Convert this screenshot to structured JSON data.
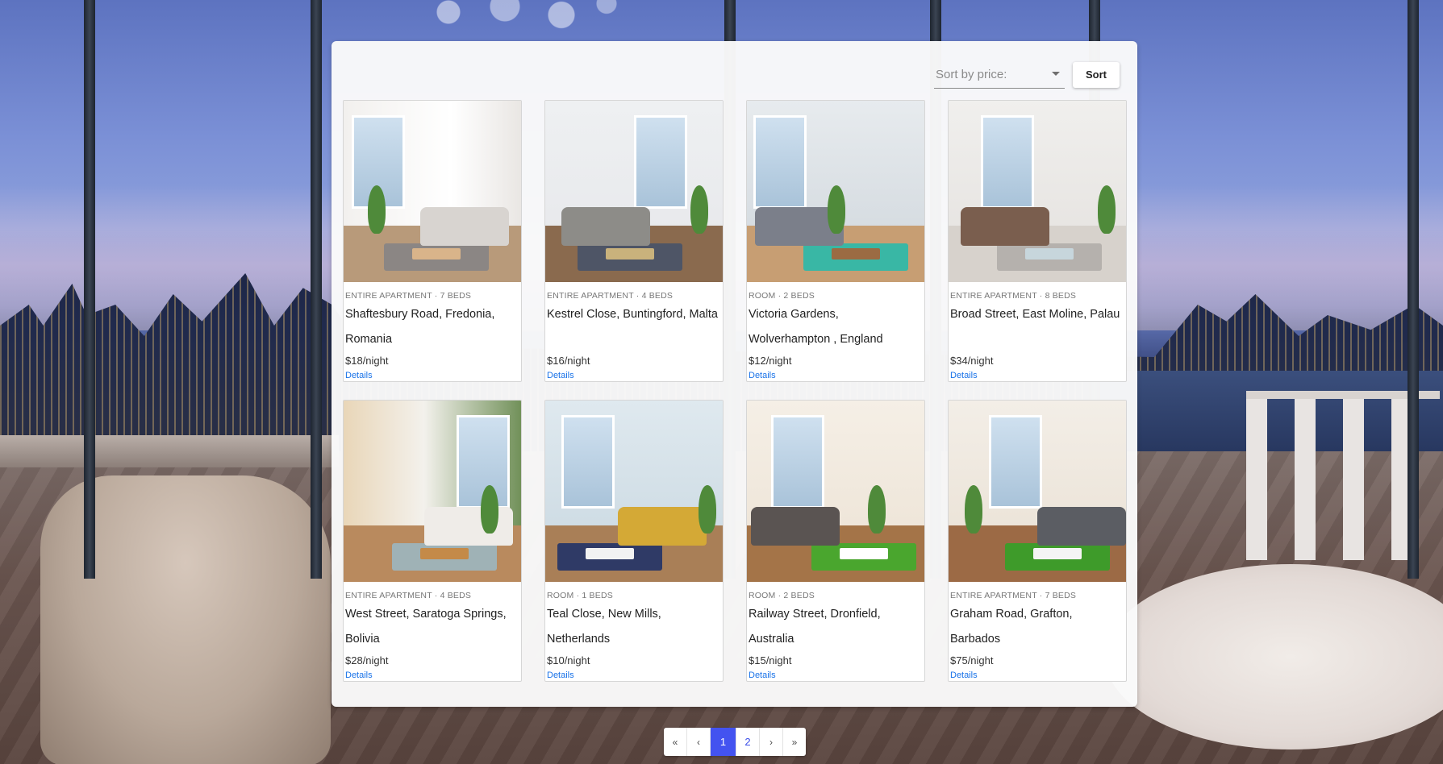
{
  "sort": {
    "placeholder": "Sort by price:",
    "button_label": "Sort"
  },
  "listings": [
    {
      "type": "ENTIRE APARTMENT · 7 BEDS",
      "title": "Shaftesbury Road, Fredonia, Romania",
      "price": "$18/night",
      "details": "Details"
    },
    {
      "type": "ENTIRE APARTMENT · 4 BEDS",
      "title": "Kestrel Close, Buntingford, Malta",
      "price": "$16/night",
      "details": "Details"
    },
    {
      "type": "ROOM · 2 BEDS",
      "title": "Victoria Gardens, Wolverhampton , England",
      "price": "$12/night",
      "details": "Details"
    },
    {
      "type": "ENTIRE APARTMENT · 8 BEDS",
      "title": "Broad Street, East Moline, Palau",
      "price": "$34/night",
      "details": "Details"
    },
    {
      "type": "ENTIRE APARTMENT · 4 BEDS",
      "title": "West Street, Saratoga Springs, Bolivia",
      "price": "$28/night",
      "details": "Details"
    },
    {
      "type": "ROOM · 1 BEDS",
      "title": "Teal Close, New Mills, Netherlands",
      "price": "$10/night",
      "details": "Details"
    },
    {
      "type": "ROOM · 2 BEDS",
      "title": "Railway Street, Dronfield, Australia",
      "price": "$15/night",
      "details": "Details"
    },
    {
      "type": "ENTIRE APARTMENT · 7 BEDS",
      "title": "Graham Road, Grafton, Barbados",
      "price": "$75/night",
      "details": "Details"
    }
  ],
  "pagination": {
    "first": "«",
    "prev": "‹",
    "pages": [
      "1",
      "2"
    ],
    "current": "1",
    "next": "›",
    "last": "»"
  },
  "colors": {
    "accent": "#4353f0",
    "link": "#1a73e8"
  }
}
